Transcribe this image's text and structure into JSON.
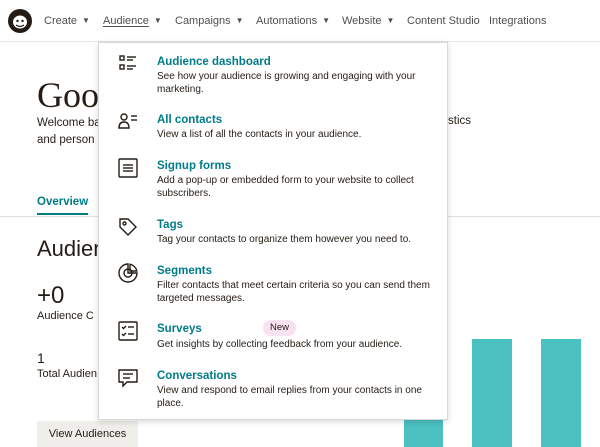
{
  "nav": {
    "items": [
      {
        "label": "Create",
        "chevron": true
      },
      {
        "label": "Audience",
        "chevron": true,
        "active": true
      },
      {
        "label": "Campaigns",
        "chevron": true
      },
      {
        "label": "Automations",
        "chevron": true
      },
      {
        "label": "Website",
        "chevron": true
      },
      {
        "label": "Content Studio",
        "chevron": false
      },
      {
        "label": "Integrations",
        "chevron": false
      }
    ]
  },
  "page": {
    "greeting": "Good",
    "welcome_line1": "Welcome ba",
    "welcome_line2": "and person",
    "welcome_right": "stics",
    "tab_overview": "Overview",
    "audience_title": "Audien",
    "plus_zero": "+0",
    "audience_change": "Audience C",
    "one": "1",
    "total_audience": "Total Audien",
    "view_audiences": "View Audiences"
  },
  "dropdown": {
    "items": [
      {
        "title": "Audience dashboard",
        "desc": "See how your audience is growing and engaging with your marketing.",
        "icon": "dashboard-icon"
      },
      {
        "title": "All contacts",
        "desc": "View a list of all the contacts in your audience.",
        "icon": "contacts-icon"
      },
      {
        "title": "Signup forms",
        "desc": "Add a pop-up or embedded form to your website to collect subscribers.",
        "icon": "form-icon"
      },
      {
        "title": "Tags",
        "desc": "Tag your contacts to organize them however you need to.",
        "icon": "tag-icon"
      },
      {
        "title": "Segments",
        "desc": "Filter contacts that meet certain criteria so you can send them targeted messages.",
        "icon": "segments-icon"
      },
      {
        "title": "Surveys",
        "desc": "Get insights by collecting feedback from your audience.",
        "icon": "survey-icon",
        "badge": "New"
      },
      {
        "title": "Conversations",
        "desc": "View and respond to email replies from your contacts in one place.",
        "icon": "conversation-icon"
      }
    ]
  },
  "colors": {
    "accent": "#007c89",
    "bar": "#4cc1c1",
    "badge_bg": "#f8e1f0",
    "text": "#241c15"
  }
}
